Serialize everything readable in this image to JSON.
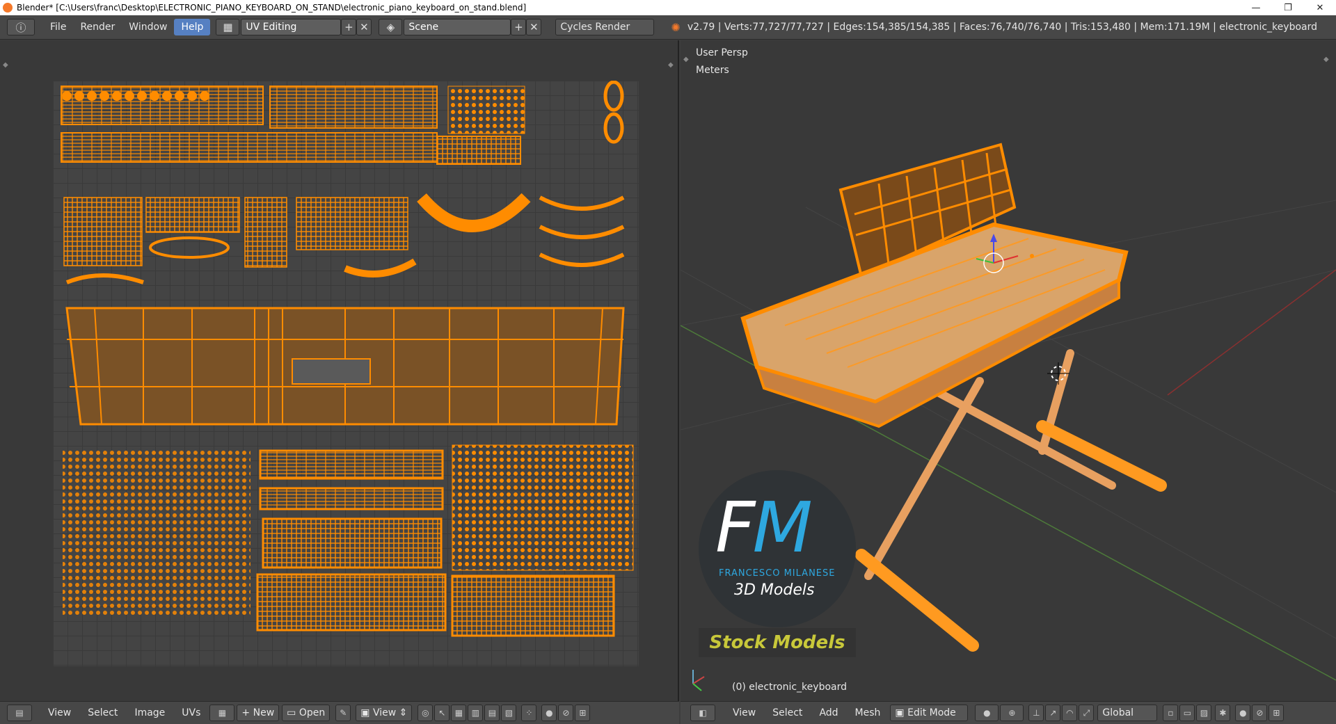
{
  "window": {
    "title": "Blender* [C:\\Users\\franc\\Desktop\\ELECTRONIC_PIANO_KEYBOARD_ON_STAND\\electronic_piano_keyboard_on_stand.blend]",
    "minimize": "—",
    "maximize": "❐",
    "close": "✕"
  },
  "menu": {
    "file": "File",
    "render": "Render",
    "window": "Window",
    "help": "Help"
  },
  "screen_layout": {
    "value": "UV Editing"
  },
  "scene": {
    "value": "Scene"
  },
  "engine": {
    "value": "Cycles Render"
  },
  "stats": "v2.79 | Verts:77,727/77,727 | Edges:154,385/154,385 | Faces:76,740/76,740 | Tris:153,480 | Mem:171.19M | electronic_keyboard",
  "viewport": {
    "view_name": "User Persp",
    "units": "Meters",
    "object_label": "(0) electronic_keyboard"
  },
  "watermark": {
    "letters_f": "F",
    "letters_m": "M",
    "name": "FRANCESCO MILANESE",
    "subtitle": "3D Models",
    "stock": "Stock Models"
  },
  "uv_footer": {
    "view": "View",
    "select": "Select",
    "image": "Image",
    "uvs": "UVs",
    "new": "New",
    "open": "Open",
    "view2": "View"
  },
  "vp_footer": {
    "view": "View",
    "select": "Select",
    "add": "Add",
    "mesh": "Mesh",
    "mode": "Edit Mode",
    "orientation": "Global"
  },
  "colors": {
    "uv_orange": "#ff8c00",
    "accent_blue": "#5680c2",
    "logo_blue": "#2ea8e0",
    "stock_yellow": "#c8c83a"
  }
}
